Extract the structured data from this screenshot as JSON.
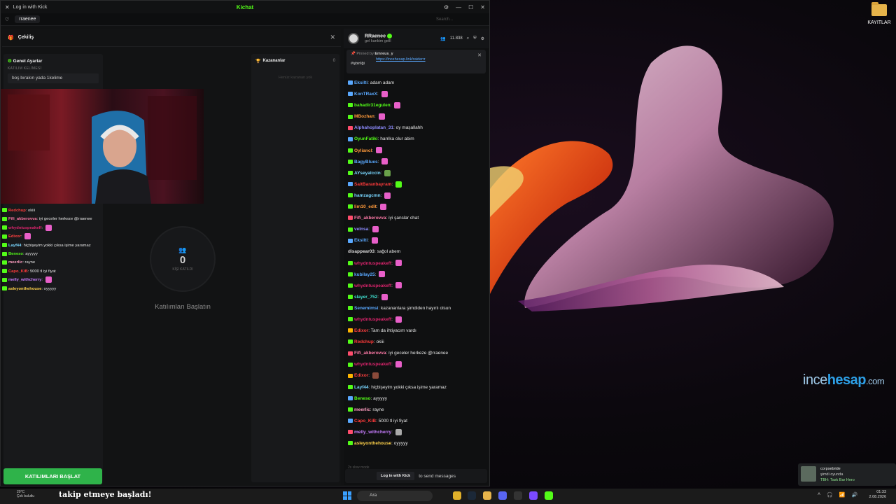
{
  "window": {
    "title": "Log in with Kick",
    "app_name": "Kichat"
  },
  "tabs": {
    "channel": "rraenee",
    "search_placeholder": "Search..."
  },
  "giveaway": {
    "title": "Çekiliş",
    "settings_title": "Genel Ayarlar",
    "keyword_label": "KATILIM KELİMESİ",
    "keyword_value": "boş bırakın yada 1kelime",
    "participant_count": "0",
    "participant_label": "KİŞİ KATILDI",
    "start_hint": "Katılımları Başlatın",
    "winners_title": "Kazananlar",
    "winners_count": "0",
    "winners_empty": "Henüz kazanan yok",
    "start_button": "KATILIMLARI BAŞLAT"
  },
  "mini_chat": [
    {
      "user": "Redchup",
      "color": "#ff3b3b",
      "text": "okiii"
    },
    {
      "user": "Fifi_akberovva",
      "color": "#ff7aa8",
      "text": "iyi geceler herkeze @rraenee"
    },
    {
      "user": "whydntuspeakeff",
      "color": "#d9246b",
      "text": ""
    },
    {
      "user": "Edixor",
      "color": "#ff4040",
      "text": ""
    },
    {
      "user": "Layf44",
      "color": "#7ad7ff",
      "text": "hiçbişeyim yokki çıksa işime yaramaz"
    },
    {
      "user": "Beneso",
      "color": "#53fc18",
      "text": "ayyyyy"
    },
    {
      "user": "meerlic",
      "color": "#ff9ec2",
      "text": "rayne"
    },
    {
      "user": "Capo_KiB",
      "color": "#ff3b3b",
      "text": "5000 tl iyi fiyat"
    },
    {
      "user": "melly_withcherry",
      "color": "#c77dff",
      "text": ""
    },
    {
      "user": "asleyonthehouse",
      "color": "#ffd24a",
      "text": "oyyyyy"
    }
  ],
  "chat": {
    "streamer": "RRaenee",
    "status": "gel kankim gelll",
    "viewers": "11.838",
    "pinned_by_label": "Pinned by",
    "pinned_by": "Emreus_y",
    "pinned_link": "https://incehesap.link/raiderrr",
    "pinned_text": "#işbirliği",
    "slow_mode": "2s slow mode",
    "login_button": "Log in with Kick",
    "login_suffix": "to send messages",
    "messages": [
      {
        "user": "Eksilti",
        "color": "#5aa9ff",
        "badge": "#5aa9ff",
        "text": "adam adam",
        "emote": ""
      },
      {
        "user": "KonTRaxX",
        "color": "#5aa9ff",
        "badge": "#5aa9ff",
        "text": "",
        "emote": "#e85fc9"
      },
      {
        "user": "bahadir31egulen",
        "color": "#53fc18",
        "badge": "#53fc18",
        "text": "",
        "emote": "#e85fc9"
      },
      {
        "user": "MBozhan",
        "color": "#ff9a3b",
        "badge": "#53fc18",
        "text": "",
        "emote": "#e85fc9"
      },
      {
        "user": "Alphahoplatan_31",
        "color": "#8e8cff",
        "badge": "#ff4d6d",
        "text": "oy maşallahh",
        "emote": ""
      },
      {
        "user": "OyunFatiki",
        "color": "#53fc18",
        "badge": "#5aa9ff",
        "text": "harrika olur abim",
        "emote": ""
      },
      {
        "user": "Oyliancl",
        "color": "#ff9a3b",
        "badge": "#53fc18",
        "text": "",
        "emote": "#e85fc9"
      },
      {
        "user": "BagyBlues",
        "color": "#5aa9ff",
        "badge": "#53fc18",
        "text": "",
        "emote": "#e85fc9"
      },
      {
        "user": "AYseyalccin",
        "color": "#7ad7ff",
        "badge": "#53fc18",
        "text": "",
        "emote": "#6aa04a"
      },
      {
        "user": "SaitBaranbayram",
        "color": "#ff3b3b",
        "badge": "#5aa9ff",
        "text": "",
        "emote": "#53fc18"
      },
      {
        "user": "hamzagcmn",
        "color": "#7ad7ff",
        "badge": "#53fc18",
        "text": "",
        "emote": "#e85fc9"
      },
      {
        "user": "lim10_edit",
        "color": "#ff9a3b",
        "badge": "#53fc18",
        "text": "",
        "emote": "#e85fc9"
      },
      {
        "user": "Fifi_akberovva",
        "color": "#ff7aa8",
        "badge": "#ff4d6d",
        "text": "iyi şanslar chat",
        "emote": ""
      },
      {
        "user": "velnsa",
        "color": "#8e8cff",
        "badge": "#53fc18",
        "text": "",
        "emote": "#e85fc9"
      },
      {
        "user": "Eksilti",
        "color": "#5aa9ff",
        "badge": "#5aa9ff",
        "text": "",
        "emote": "#e85fc9"
      },
      {
        "user": "disappear03",
        "color": "#dddddd",
        "badge": "",
        "text": "sağol abem",
        "emote": ""
      },
      {
        "user": "whydntuspeakeff",
        "color": "#d9246b",
        "badge": "#53fc18",
        "text": "",
        "emote": "#e85fc9"
      },
      {
        "user": "kubilay25",
        "color": "#5aa9ff",
        "badge": "#53fc18",
        "text": "",
        "emote": "#e85fc9"
      },
      {
        "user": "whydntuspeakeff",
        "color": "#d9246b",
        "badge": "#53fc18",
        "text": "",
        "emote": "#e85fc9"
      },
      {
        "user": "slayer_752",
        "color": "#40e0d0",
        "badge": "#53fc18",
        "text": "",
        "emote": "#e85fc9"
      },
      {
        "user": "Senemimsi",
        "color": "#5aa9ff",
        "badge": "#53fc18",
        "text": "kazananlara şimdiden hayırlı olsun",
        "emote": ""
      },
      {
        "user": "whydntuspeakeff",
        "color": "#d9246b",
        "badge": "#53fc18",
        "text": "",
        "emote": "#e85fc9"
      },
      {
        "user": "Edixor",
        "color": "#ff4040",
        "badge": "#ffb400",
        "text": "Tam da ihtiyacım vardı",
        "emote": ""
      },
      {
        "user": "Redchup",
        "color": "#ff3b3b",
        "badge": "#53fc18",
        "text": "okiii",
        "emote": ""
      },
      {
        "user": "Fifi_akberovva",
        "color": "#ff7aa8",
        "badge": "#ff4d6d",
        "text": "iyi geceler herkeze @rraenee",
        "emote": ""
      },
      {
        "user": "whydntuspeakeff",
        "color": "#d9246b",
        "badge": "#53fc18",
        "text": "",
        "emote": "#e85fc9"
      },
      {
        "user": "Edixor",
        "color": "#ff4040",
        "badge": "#ffb400",
        "text": "",
        "emote": "#8a4a3a"
      },
      {
        "user": "Layf44",
        "color": "#7ad7ff",
        "badge": "#53fc18",
        "text": "hiçbişeyim yokki çıksa işime yaramaz",
        "emote": ""
      },
      {
        "user": "Beneso",
        "color": "#53fc18",
        "badge": "#5aa9ff",
        "text": "ayyyyy",
        "emote": ""
      },
      {
        "user": "meerlic",
        "color": "#ff9ec2",
        "badge": "#53fc18",
        "text": "rayne",
        "emote": ""
      },
      {
        "user": "Capo_KiB",
        "color": "#ff3b3b",
        "badge": "#5aa9ff",
        "text": "5000 tl iyi fiyat",
        "emote": ""
      },
      {
        "user": "melly_withcherry",
        "color": "#c77dff",
        "badge": "#ff4d6d",
        "text": "",
        "emote": "#aaaaaa"
      },
      {
        "user": "asleyonthehouse",
        "color": "#ffd24a",
        "badge": "#53fc18",
        "text": "oyyyyy",
        "emote": ""
      }
    ]
  },
  "desktop": {
    "folder_label": "KAYITLAR",
    "watermark_a": "ince",
    "watermark_b": "hesap",
    "watermark_c": ".com"
  },
  "taskbar": {
    "weather": "20°C",
    "weather_desc": "Çok bulutlu",
    "follow_alert": "takip etmeye başladı!",
    "search": "Ara",
    "time": "01:33",
    "date": "2.08.2026"
  },
  "notification": {
    "user": "corpsebride",
    "status": "şimdi oyunda",
    "game": "TBH: Task Bar Hero"
  }
}
